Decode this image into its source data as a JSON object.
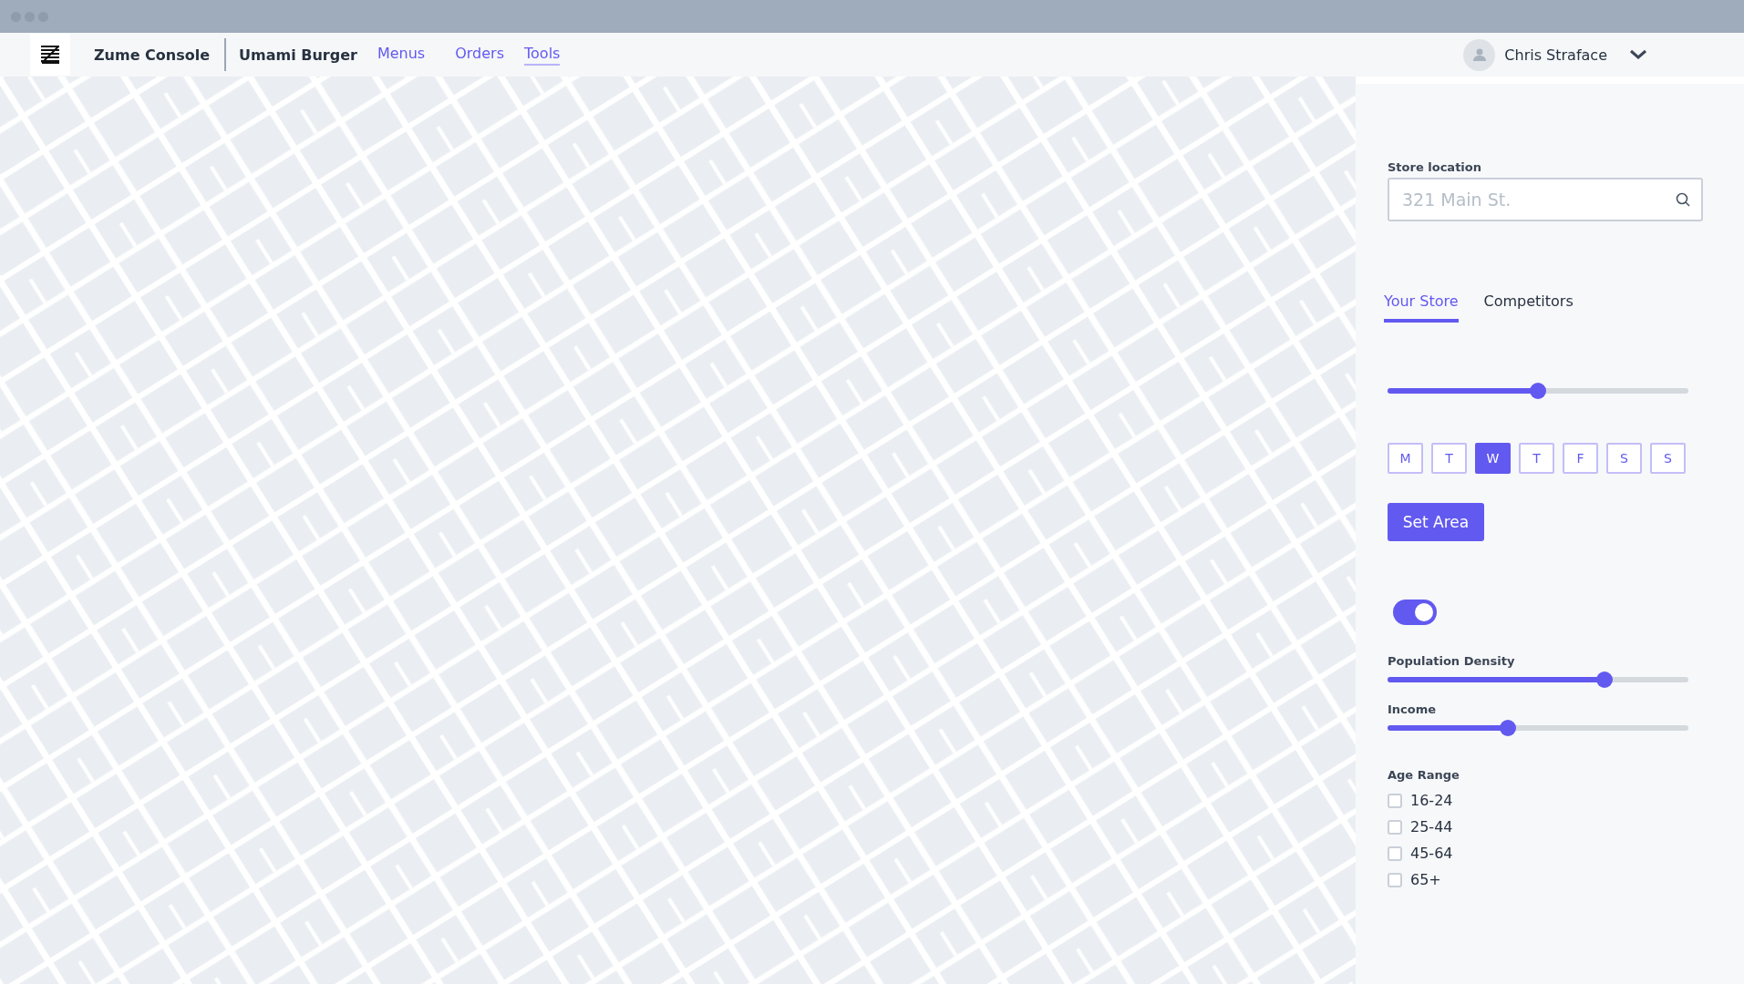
{
  "nav": {
    "app_name": "Zume Console",
    "account": "Umami Burger",
    "links": [
      {
        "label": "Menus",
        "selected": false
      },
      {
        "label": "Orders",
        "selected": false
      },
      {
        "label": "Tools",
        "selected": true
      }
    ],
    "user": {
      "name": "Chris Straface"
    }
  },
  "panel": {
    "store_location": {
      "label": "Store location",
      "placeholder": "321 Main St."
    },
    "tabs": [
      {
        "label": "Your Store",
        "selected": true
      },
      {
        "label": "Competitors",
        "selected": false
      }
    ],
    "time_slider": {
      "level": 0.5
    },
    "days": [
      {
        "label": "M",
        "selected": false
      },
      {
        "label": "T",
        "selected": false
      },
      {
        "label": "W",
        "selected": true
      },
      {
        "label": "T",
        "selected": false
      },
      {
        "label": "F",
        "selected": false
      },
      {
        "label": "S",
        "selected": false
      },
      {
        "label": "S",
        "selected": false
      }
    ],
    "set_area_button": "Set Area",
    "toggle": {
      "on": true
    },
    "filters": [
      {
        "label": "Population Density",
        "level": 0.72
      },
      {
        "label": "Income",
        "level": 0.4
      }
    ],
    "age_range": {
      "label": "Age Range",
      "options": [
        {
          "label": "16-24",
          "checked": false
        },
        {
          "label": "25-44",
          "checked": false
        },
        {
          "label": "45-64",
          "checked": false
        },
        {
          "label": "65+",
          "checked": false
        }
      ]
    }
  }
}
